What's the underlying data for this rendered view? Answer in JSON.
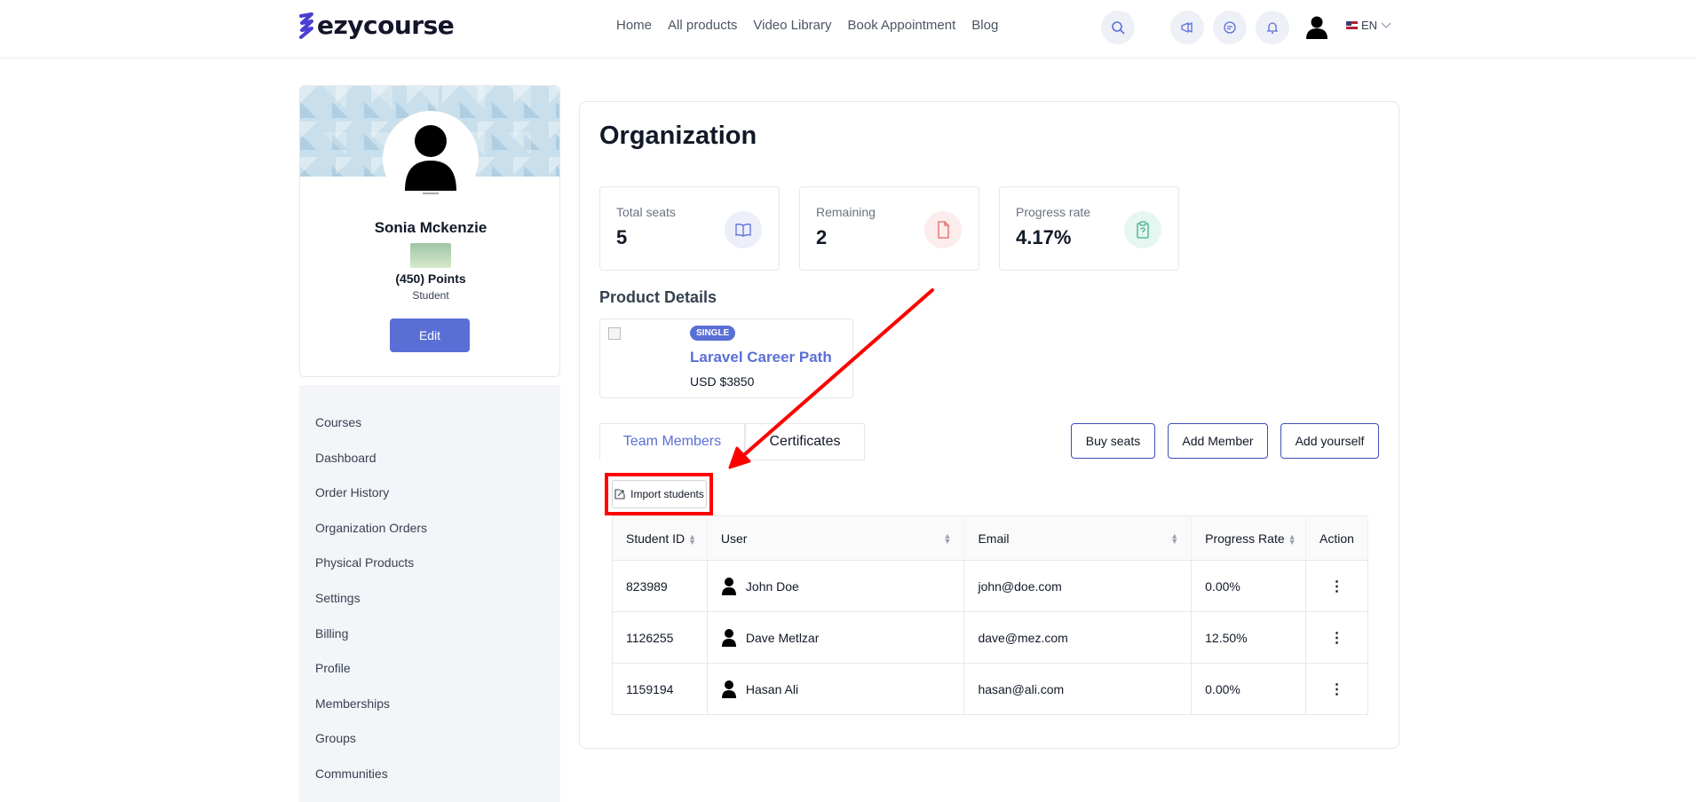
{
  "header": {
    "logo_text": "ezycourse",
    "nav": [
      "Home",
      "All products",
      "Video Library",
      "Book Appointment",
      "Blog"
    ],
    "lang": "EN",
    "icons": [
      "search-icon",
      "megaphone-icon",
      "chat-icon",
      "bell-icon"
    ]
  },
  "profile": {
    "name": "Sonia Mckenzie",
    "points": "(450) Points",
    "role": "Student",
    "edit_label": "Edit"
  },
  "sidebar": {
    "items": [
      "Courses",
      "Dashboard",
      "Order History",
      "Organization Orders",
      "Physical Products",
      "Settings",
      "Billing",
      "Profile",
      "Memberships",
      "Groups",
      "Communities"
    ]
  },
  "main": {
    "title": "Organization",
    "stats": [
      {
        "label": "Total seats",
        "value": "5",
        "icon": "book-icon",
        "color": "#5a6fd6",
        "bg": "#eceefa"
      },
      {
        "label": "Remaining",
        "value": "2",
        "icon": "file-icon",
        "color": "#e06666",
        "bg": "#fdecec"
      },
      {
        "label": "Progress rate",
        "value": "4.17%",
        "icon": "clipboard-icon",
        "color": "#3bb08f",
        "bg": "#e6f6f0"
      }
    ],
    "product_section_title": "Product Details",
    "product": {
      "badge": "SINGLE",
      "title": "Laravel Career Path",
      "price": "USD $3850"
    },
    "tabs": [
      "Team Members",
      "Certificates"
    ],
    "buttons": {
      "buy_seats": "Buy seats",
      "add_member": "Add Member",
      "add_yourself": "Add yourself"
    },
    "import_label": "Import students",
    "table": {
      "columns": [
        "Student ID",
        "User",
        "Email",
        "Progress Rate",
        "Action"
      ],
      "rows": [
        {
          "id": "823989",
          "user": "John Doe",
          "email": "john@doe.com",
          "progress": "0.00%"
        },
        {
          "id": "1126255",
          "user": "Dave Metlzar",
          "email": "dave@mez.com",
          "progress": "12.50%"
        },
        {
          "id": "1159194",
          "user": "Hasan Ali",
          "email": "hasan@ali.com",
          "progress": "0.00%"
        }
      ]
    }
  },
  "annotation": {
    "color": "#ff0000"
  }
}
